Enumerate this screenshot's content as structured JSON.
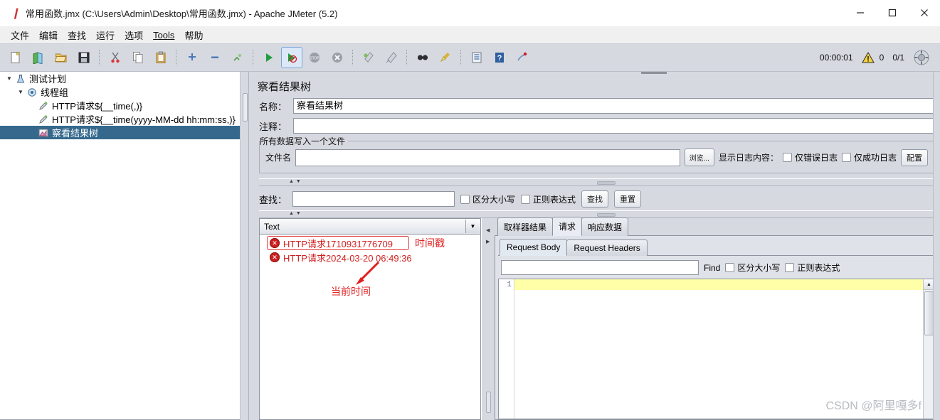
{
  "window": {
    "title": "常用函数.jmx (C:\\Users\\Admin\\Desktop\\常用函数.jmx) - Apache JMeter (5.2)",
    "app_icon": "jmeter-feather-icon",
    "minimize": "—",
    "maximize": "☐",
    "close": "✕"
  },
  "menu": {
    "items": [
      {
        "label": "文件"
      },
      {
        "label": "编辑"
      },
      {
        "label": "查找"
      },
      {
        "label": "运行"
      },
      {
        "label": "选项"
      },
      {
        "label": "Tools"
      },
      {
        "label": "帮助"
      }
    ]
  },
  "toolbar": {
    "buttons": [
      {
        "name": "new-icon",
        "glyph": "🗋"
      },
      {
        "name": "templates-icon",
        "glyph": "📗"
      },
      {
        "name": "open-icon",
        "glyph": "📂"
      },
      {
        "name": "save-icon",
        "glyph": "💾"
      },
      {
        "name": "cut-icon",
        "glyph": "✂"
      },
      {
        "name": "copy-icon",
        "glyph": "🗐"
      },
      {
        "name": "paste-icon",
        "glyph": "📋"
      },
      {
        "name": "expand-all-icon",
        "glyph": "✛"
      },
      {
        "name": "collapse-all-icon",
        "glyph": "▬"
      },
      {
        "name": "toggle-icon",
        "glyph": "🖈"
      },
      {
        "name": "start-icon",
        "glyph": "▶"
      },
      {
        "name": "start-no-pauses-icon",
        "glyph": "▶"
      },
      {
        "name": "stop-icon",
        "glyph": "⬤"
      },
      {
        "name": "shutdown-icon",
        "glyph": "✖"
      },
      {
        "name": "clear-icon",
        "glyph": "🧹"
      },
      {
        "name": "clear-all-icon",
        "glyph": "🧹"
      },
      {
        "name": "search-icon",
        "glyph": "🔍"
      },
      {
        "name": "search-reset-icon",
        "glyph": "🖌"
      },
      {
        "name": "function-helper-icon",
        "glyph": "📓"
      },
      {
        "name": "help-icon",
        "glyph": "❓"
      },
      {
        "name": "undo-icon",
        "glyph": "🎯"
      }
    ],
    "timer": "00:00:01",
    "warning_icon": "warning-triangle-icon",
    "warning_count": "0",
    "threads": "0/1",
    "connect_icon": "connect-status-icon"
  },
  "tree": {
    "nodes": [
      {
        "label": "测试计划",
        "icon": "test-plan-icon",
        "indent": 0,
        "twisty": "▼",
        "selected": false
      },
      {
        "label": "线程组",
        "icon": "thread-group-icon",
        "indent": 1,
        "twisty": "▼",
        "selected": false
      },
      {
        "label": "HTTP请求${__time(,)}",
        "icon": "http-request-icon",
        "indent": 2,
        "twisty": "",
        "selected": false
      },
      {
        "label": "HTTP请求${__time(yyyy-MM-dd hh:mm:ss,)}",
        "icon": "http-request-icon",
        "indent": 2,
        "twisty": "",
        "selected": false
      },
      {
        "label": "察看结果树",
        "icon": "view-results-tree-icon",
        "indent": 2,
        "twisty": "",
        "selected": true
      }
    ]
  },
  "panel": {
    "title": "察看结果树",
    "name_label": "名称：",
    "name_value": "察看结果树",
    "comment_label": "注释：",
    "comment_value": "",
    "file_group_legend": "所有数据写入一个文件",
    "filename_label": "文件名",
    "filename_value": "",
    "browse_button": "浏览...",
    "log_display_label": "显示日志内容：",
    "errors_only_label": "仅错误日志",
    "successes_only_label": "仅成功日志",
    "configure_button": "配置"
  },
  "search": {
    "label": "查找：",
    "value": "",
    "case_sensitive_label": "区分大小写",
    "regexp_label": "正则表达式",
    "find_button": "查找",
    "reset_button": "重置"
  },
  "results": {
    "renderer_selected": "Text",
    "items": [
      {
        "label": "HTTP请求1710931776709",
        "status": "error"
      },
      {
        "label": "HTTP请求2024-03-20 06:49:36",
        "status": "error"
      }
    ],
    "annotations": [
      {
        "text": "时间戳",
        "kind": "label"
      },
      {
        "text": "当前时间",
        "kind": "label-with-arrow"
      }
    ]
  },
  "detail": {
    "tabs": [
      {
        "label": "取样器结果",
        "active": false
      },
      {
        "label": "请求",
        "active": true
      },
      {
        "label": "响应数据",
        "active": false
      }
    ],
    "subtabs": [
      {
        "label": "Request Body",
        "active": true
      },
      {
        "label": "Request Headers",
        "active": false
      }
    ],
    "find": {
      "value": "",
      "find_label": "Find",
      "case_sensitive_label": "区分大小写",
      "regexp_label": "正则表达式"
    },
    "editor": {
      "line_numbers": [
        "1"
      ],
      "content": ""
    }
  },
  "watermark": "CSDN @阿里嘎多f"
}
